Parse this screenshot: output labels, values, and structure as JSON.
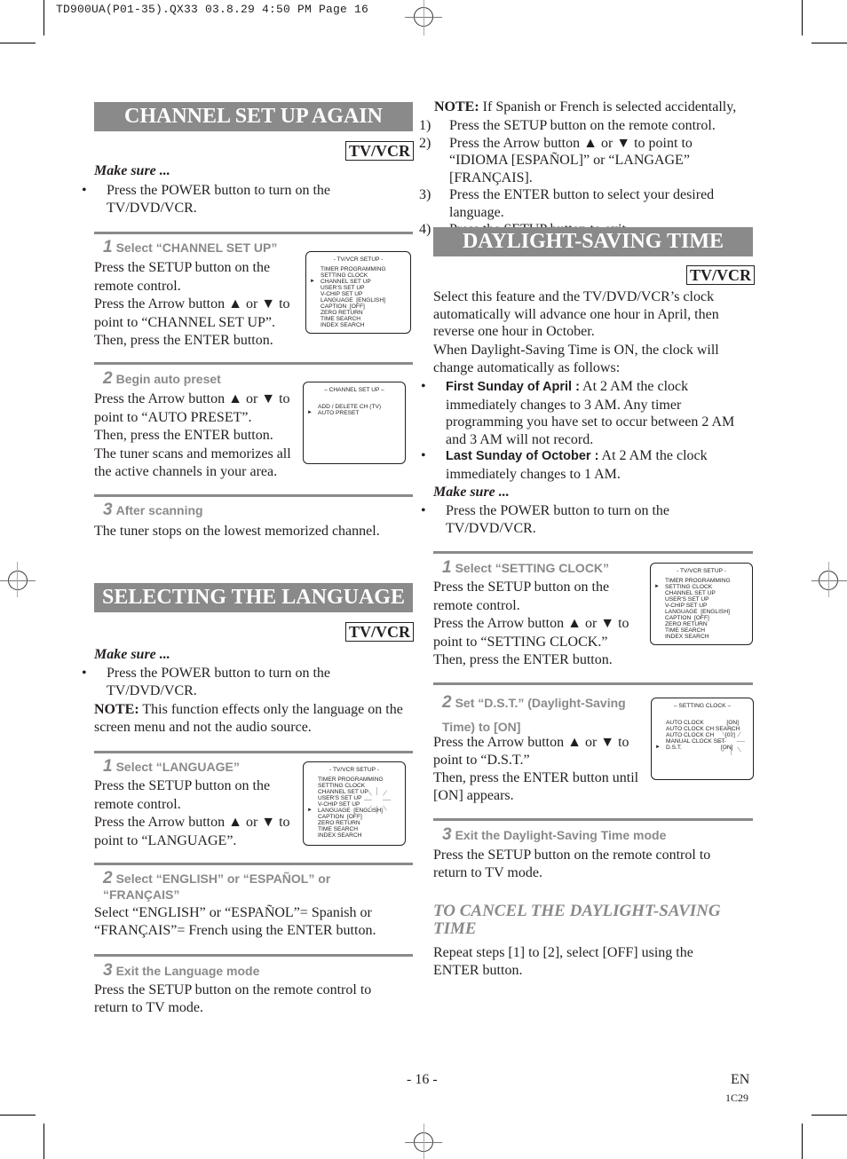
{
  "slug": "TD900UA(P01-35).QX33  03.8.29 4:50 PM  Page 16",
  "icons": {
    "up_arrow": "▲",
    "down_arrow": "▼",
    "pointer": "►",
    "bullet": "•"
  },
  "channel_setup": {
    "title": "CHANNEL SET UP AGAIN",
    "badge": "TV/VCR",
    "make_sure": "Make sure ...",
    "make_sure_item": "Press the POWER button to turn on the TV/DVD/VCR.",
    "steps": [
      {
        "num": "1",
        "title": "Select “CHANNEL SET UP”",
        "body": [
          "Press the SETUP button on the remote control.",
          "Press the Arrow button ▲ or ▼ to point to “CHANNEL SET UP”.",
          "Then, press the ENTER button."
        ]
      },
      {
        "num": "2",
        "title": "Begin auto preset",
        "body": [
          "Press the Arrow button ▲ or ▼ to point to “AUTO PRESET”.",
          "Then, press the ENTER button.",
          "The tuner scans and memorizes all the active channels in your area."
        ]
      },
      {
        "num": "3",
        "title": "After scanning",
        "body": [
          "The tuner stops on the lowest memorized channel."
        ]
      }
    ],
    "osd1": {
      "title": "- TV/VCR SETUP -",
      "items": [
        "TIMER PROGRAMMING",
        "SETTING CLOCK",
        "CHANNEL SET UP",
        "USER'S SET UP",
        "V-CHIP SET UP",
        "LANGUAGE  [ENGLISH]",
        "CAPTION  [OFF]",
        "ZERO RETURN",
        "TIME SEARCH",
        "INDEX SEARCH"
      ],
      "selected": 2
    },
    "osd2": {
      "title": "– CHANNEL SET UP –",
      "items": [
        "ADD / DELETE CH (TV)",
        "AUTO PRESET"
      ],
      "selected": 1
    }
  },
  "language": {
    "title": "SELECTING THE LANGUAGE",
    "badge": "TV/VCR",
    "make_sure": "Make sure ...",
    "make_sure_item": "Press the POWER button to turn on the TV/DVD/VCR.",
    "note_label": "NOTE:",
    "note_text": "This function effects only the language on the screen menu and not the audio source.",
    "steps": [
      {
        "num": "1",
        "title": "Select “LANGUAGE”",
        "body": [
          "Press the SETUP button on the remote control.",
          "Press the Arrow button ▲ or ▼ to point to “LANGUAGE”."
        ]
      },
      {
        "num": "2",
        "title": "Select “ENGLISH” or “ESPAÑOL” or “FRANÇAIS”",
        "body": [
          "Select “ENGLISH” or “ESPAÑOL”= Spanish or “FRANÇAIS”= French using the ENTER button."
        ]
      },
      {
        "num": "3",
        "title": "Exit the Language mode",
        "body": [
          "Press the SETUP button on the remote control to return to TV mode."
        ]
      }
    ],
    "osd": {
      "title": "- TV/VCR SETUP -",
      "items": [
        "TIMER PROGRAMMING",
        "SETTING CLOCK",
        "CHANNEL SET UP",
        "USER'S SET UP",
        "V-CHIP SET UP",
        "LANGUAGE  [ENGLISH]",
        "CAPTION  [OFF]",
        "ZERO RETURN",
        "TIME SEARCH",
        "INDEX SEARCH"
      ],
      "selected": 5
    }
  },
  "note": {
    "label": "NOTE:",
    "text": "If Spanish or French is selected accidentally,",
    "items": [
      {
        "n": "1)",
        "text": "Press the SETUP button on the remote control."
      },
      {
        "n": "2)",
        "text": "Press the Arrow button ▲ or ▼ to point to “IDIOMA [ESPAÑOL]” or “LANGAGE” [FRANÇAIS]."
      },
      {
        "n": "3)",
        "text": "Press the ENTER button to select your desired language."
      },
      {
        "n": "4)",
        "text": "Press the SETUP button to exit."
      }
    ]
  },
  "dst": {
    "title": "DAYLIGHT-SAVING TIME",
    "badge": "TV/VCR",
    "intro1": "Select this feature and the TV/DVD/VCR’s clock automatically will advance one hour in April, then reverse one hour in October.",
    "intro2": "When Daylight-Saving Time is ON, the clock will change automatically as follows:",
    "bullets": [
      {
        "label": "First Sunday of April :",
        "text": "At 2 AM the clock immediately changes to 3 AM. Any timer programming you have set to occur between 2 AM and 3 AM will not record."
      },
      {
        "label": "Last Sunday of October :",
        "text": "At 2 AM the clock immediately changes to 1 AM."
      }
    ],
    "make_sure": "Make sure ...",
    "make_sure_item": "Press the POWER button to turn on the TV/DVD/VCR.",
    "steps": [
      {
        "num": "1",
        "title": "Select “SETTING CLOCK”",
        "body": [
          "Press the SETUP button on the remote control.",
          "Press the Arrow button ▲ or ▼ to point to “SETTING CLOCK.”",
          "Then, press the ENTER button."
        ]
      },
      {
        "num": "2",
        "title": "Set “D.S.T.” (Daylight-Saving Time) to [ON]",
        "body": [
          "Press the Arrow button ▲ or ▼ to point to “D.S.T.”",
          "Then, press the ENTER button until [ON] appears."
        ]
      },
      {
        "num": "3",
        "title": "Exit the Daylight-Saving Time mode",
        "body": [
          "Press the SETUP button on the remote control to return to TV mode."
        ]
      }
    ],
    "osd1": {
      "title": "- TV/VCR SETUP -",
      "items": [
        "TIMER PROGRAMMING",
        "SETTING CLOCK",
        "CHANNEL SET UP",
        "USER'S SET UP",
        "V-CHIP SET UP",
        "LANGUAGE  [ENGLISH]",
        "CAPTION  [OFF]",
        "ZERO RETURN",
        "TIME SEARCH",
        "INDEX SEARCH"
      ],
      "selected": 1
    },
    "osd2": {
      "title": "– SETTING CLOCK –",
      "items": [
        "AUTO CLOCK              [ON]",
        "AUTO CLOCK CH SEARCH",
        "AUTO CLOCK CH       [02]",
        "MANUAL CLOCK SET",
        "D.S.T.                        [ON]"
      ],
      "selected": 4
    },
    "cancel_title": "TO CANCEL THE DAYLIGHT-SAVING TIME",
    "cancel_text": "Repeat steps [1] to [2], select [OFF] using the ENTER button."
  },
  "footer": {
    "page": "- 16 -",
    "lang": "EN",
    "code": "1C29"
  }
}
